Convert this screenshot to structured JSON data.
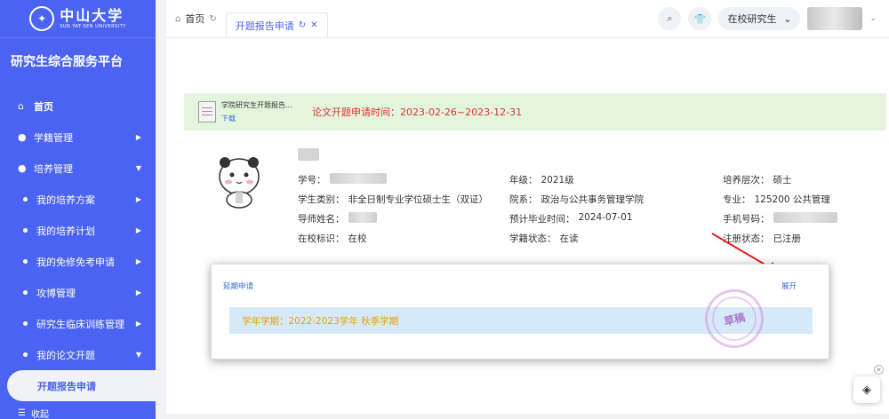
{
  "logo": {
    "name_cn": "中山大学",
    "name_en": "SUN YAT-SEN UNIVERSITY"
  },
  "platform_title": "研究生综合服务平台",
  "sidebar": {
    "items": [
      {
        "label": "首页",
        "icon": "home-icon"
      },
      {
        "label": "学籍管理",
        "icon": "user-icon"
      },
      {
        "label": "培养管理",
        "icon": "user-icon"
      }
    ],
    "sub_items": [
      {
        "label": "我的培养方案"
      },
      {
        "label": "我的培养计划"
      },
      {
        "label": "我的免修免考申请"
      },
      {
        "label": "攻博管理"
      },
      {
        "label": "研究生临床训练管理"
      },
      {
        "label": "我的论文开题"
      }
    ],
    "active_item": "开题报告申请",
    "collapse_label": "收起"
  },
  "tabs": [
    {
      "label": "首页"
    },
    {
      "label": "开题报告申请"
    }
  ],
  "header": {
    "role_select": "在校研究生"
  },
  "notice": {
    "file_name": "学院研究生开题报告...",
    "download_label": "下载",
    "text": "论文开题申请时间：2023-02-26~2023-12-31"
  },
  "profile": {
    "student_id_label": "学号：",
    "grade_label": "年级：",
    "grade_value": "2021级",
    "level_label": "培养层次：",
    "level_value": "硕士",
    "category_label": "学生类别：",
    "category_value": "非全日制专业学位硕士生（双证）",
    "school_label": "院系：",
    "school_value": "政治与公共事务管理学院",
    "major_label": "专业：",
    "major_value": "125200 公共管理",
    "advisor_label": "导师姓名：",
    "graduation_label": "预计毕业时间：",
    "graduation_value": "2024-07-01",
    "phone_label": "手机号码：",
    "enrollment_label": "在校标识：",
    "enrollment_value": "在校",
    "status_label": "学籍状态：",
    "status_value": "在读",
    "registration_label": "注册状态：",
    "registration_value": "已注册"
  },
  "panel": {
    "link": "延期申请",
    "expand": "展开",
    "semester": "学年学期：2022-2023学年 秋季学期",
    "stamp": "草稿"
  },
  "colors": {
    "sidebar": "#4b63f2",
    "accent": "#2f6fdc",
    "notice_bg": "#e3f6dd",
    "warning": "#e03030"
  }
}
